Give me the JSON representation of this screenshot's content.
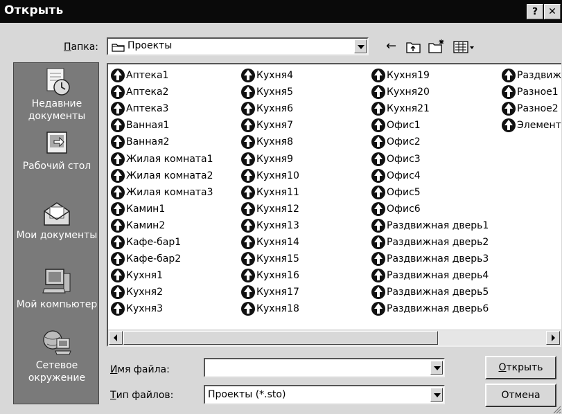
{
  "window": {
    "title": "Открыть",
    "help_label": "?",
    "close_label": "✕"
  },
  "folder": {
    "label_u": "П",
    "label_rest": "апка:",
    "value": "Проекты"
  },
  "toolbar": {
    "back": "←",
    "up": "⇧",
    "new_folder": "✳",
    "views": "▦▾"
  },
  "places": [
    {
      "label": "Недавние документы",
      "icon": "recent-documents-icon"
    },
    {
      "label": "Рабочий стол",
      "icon": "desktop-icon"
    },
    {
      "label": "Мои документы",
      "icon": "my-documents-icon"
    },
    {
      "label": "Мой компьютер",
      "icon": "my-computer-icon"
    },
    {
      "label": "Сетевое окружение",
      "icon": "network-icon"
    }
  ],
  "files": [
    [
      "Аптека1",
      "Аптека2",
      "Аптека3",
      "Ванная1",
      "Ванная2",
      "Жилая комната1",
      "Жилая комната2",
      "Жилая комната3",
      "Камин1",
      "Камин2",
      "Кафе-бар1",
      "Кафе-бар2",
      "Кухня1",
      "Кухня2",
      "Кухня3"
    ],
    [
      "Кухня4",
      "Кухня5",
      "Кухня6",
      "Кухня7",
      "Кухня8",
      "Кухня9",
      "Кухня10",
      "Кухня11",
      "Кухня12",
      "Кухня13",
      "Кухня14",
      "Кухня15",
      "Кухня16",
      "Кухня17",
      "Кухня18"
    ],
    [
      "Кухня19",
      "Кухня20",
      "Кухня21",
      "Офис1",
      "Офис2",
      "Офис3",
      "Офис4",
      "Офис5",
      "Офис6",
      "Раздвижная дверь1",
      "Раздвижная дверь2",
      "Раздвижная дверь3",
      "Раздвижная дверь4",
      "Раздвижная дверь5",
      "Раздвижная дверь6"
    ],
    [
      "Раздвиж",
      "Разное1",
      "Разное2",
      "Элемент"
    ]
  ],
  "filename": {
    "label_u": "И",
    "label_rest": "мя файла:",
    "value": ""
  },
  "filetype": {
    "label_u": "Т",
    "label_rest": "ип файлов:",
    "value": "Проекты (*.sto)"
  },
  "buttons": {
    "open_u": "О",
    "open_rest": "ткрыть",
    "cancel": "Отмена"
  }
}
